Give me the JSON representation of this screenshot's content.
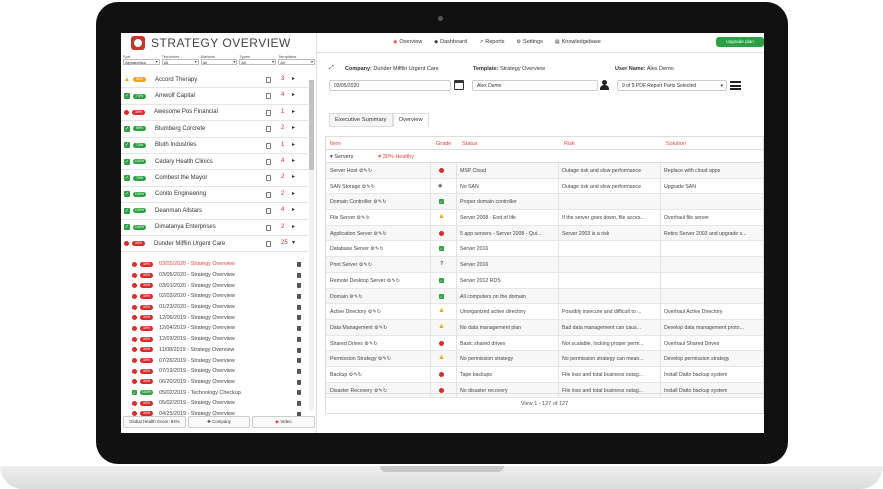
{
  "app": {
    "title": "STRATEGY OVERVIEW"
  },
  "filters": [
    {
      "label": "Sort",
      "value": "Alphabetica"
    },
    {
      "label": "Territories",
      "value": "All"
    },
    {
      "label": "Markets",
      "value": "All"
    },
    {
      "label": "Types",
      "value": "All"
    },
    {
      "label": "Templates",
      "value": "All"
    }
  ],
  "clients": [
    {
      "status": "warning",
      "score": "52%",
      "name": "Accord Therapy",
      "count": "3"
    },
    {
      "status": "ok",
      "score": "70%",
      "name": "Amwolf Capital",
      "count": "4"
    },
    {
      "status": "critical",
      "score": "35%",
      "name": "Awesome Pos Financial",
      "count": "1"
    },
    {
      "status": "ok",
      "score": "59%",
      "name": "Blumberg Corcrete",
      "count": "2"
    },
    {
      "status": "ok",
      "score": "73%",
      "name": "Bluth Industries",
      "count": "1"
    },
    {
      "status": "ok",
      "score": "100%",
      "name": "Cedary Health Clinics",
      "count": "4"
    },
    {
      "status": "ok",
      "score": "75%",
      "name": "Combest the Mayor",
      "count": "2"
    },
    {
      "status": "ok",
      "score": "100%",
      "name": "Conito Engineering",
      "count": "2"
    },
    {
      "status": "ok",
      "score": "100%",
      "name": "Deanman Allstars",
      "count": "4"
    },
    {
      "status": "ok",
      "score": "100%",
      "name": "Dimatanya Enterprises",
      "count": "2"
    },
    {
      "status": "critical",
      "score": "30%",
      "name": "Dunder Mifflin Urgent Care",
      "count": "25"
    }
  ],
  "reports": [
    {
      "status": "critical",
      "score": "30%",
      "label": "03/05/2020 - Strategy Overview",
      "active": true
    },
    {
      "status": "critical",
      "score": "30%",
      "label": "03/05/2020 - Strategy Overview",
      "active": false
    },
    {
      "status": "critical",
      "score": "30%",
      "label": "03/01/2020 - Strategy Overview",
      "active": false
    },
    {
      "status": "critical",
      "score": "30%",
      "label": "02/03/2020 - Strategy Overview",
      "active": false
    },
    {
      "status": "critical",
      "score": "30%",
      "label": "01/23/2020 - Strategy Overview",
      "active": false
    },
    {
      "status": "critical",
      "score": "30%",
      "label": "12/06/2019 - Strategy Overview",
      "active": false
    },
    {
      "status": "critical",
      "score": "30%",
      "label": "12/04/2019 - Strategy Overview",
      "active": false
    },
    {
      "status": "critical",
      "score": "30%",
      "label": "12/03/2019 - Strategy Overview",
      "active": false
    },
    {
      "status": "critical",
      "score": "30%",
      "label": "11/08/2019 - Strategy Overview",
      "active": false
    },
    {
      "status": "critical",
      "score": "30%",
      "label": "07/26/2019 - Strategy Overview",
      "active": false
    },
    {
      "status": "critical",
      "score": "30%",
      "label": "07/19/2019 - Strategy Overview",
      "active": false
    },
    {
      "status": "critical",
      "score": "30%",
      "label": "06/20/2019 - Strategy Overview",
      "active": false
    },
    {
      "status": "ok",
      "score": "100%",
      "label": "05/02/2019 - Technology Checkup",
      "active": false
    },
    {
      "status": "critical",
      "score": "30%",
      "label": "05/02/2019 - Strategy Overview",
      "active": false
    },
    {
      "status": "critical",
      "score": "30%",
      "label": "04/25/2019 - Strategy Overview",
      "active": false
    }
  ],
  "sidebar_footer": {
    "health": "Global Health Score: 84%",
    "company": "Company",
    "video": "Video"
  },
  "nav": [
    {
      "icon": "◉",
      "label": "Overview"
    },
    {
      "icon": "◆",
      "label": "Dashboard"
    },
    {
      "icon": "↗",
      "label": "Reports"
    },
    {
      "icon": "⚙",
      "label": "Settings"
    },
    {
      "icon": "▤",
      "label": "Knowledgebase"
    }
  ],
  "upgrade": "Upgrade plan",
  "info": {
    "company_label": "Company:",
    "company": "Dunder Mifflin Urgent Care",
    "template_label": "Template:",
    "template": "Strategy Overview",
    "user_label": "User Name:",
    "user": "Alex Demo"
  },
  "inputs": {
    "date": "03/05/2020",
    "user": "Alex Demo",
    "parts": "9 of 9 PDF Report Parts Selected"
  },
  "tabs": [
    "Executive Summary",
    "Overview"
  ],
  "table": {
    "headers": [
      "Item",
      "Grade",
      "Status",
      "Risk",
      "Solution"
    ],
    "group": {
      "name": "Servers",
      "score": "30% Healthy"
    },
    "rows": [
      {
        "item": "Server Host",
        "grade": "critical",
        "status": "MSP Cloud",
        "risk": "Outage risk and slow performance",
        "solution": "Replace with cloud apps"
      },
      {
        "item": "SAN Storage",
        "grade": "info",
        "status": "No SAN",
        "risk": "Outage risk and slow performance",
        "solution": "Upgrade SAN"
      },
      {
        "item": "Domain Controller",
        "grade": "ok",
        "status": "Proper domain controller",
        "risk": "",
        "solution": ""
      },
      {
        "item": "File Server",
        "grade": "warning",
        "status": "Server 2008 - End of life",
        "risk": "If the server goes down, file acces...",
        "solution": "Overhaul file server"
      },
      {
        "item": "Application Server",
        "grade": "critical",
        "status": "5 app servers - Server 2008 - Qui...",
        "risk": "Server 2003 is a risk",
        "solution": "Retire Server 2003 and upgrade s..."
      },
      {
        "item": "Database Server",
        "grade": "ok",
        "status": "Server 2016",
        "risk": "",
        "solution": ""
      },
      {
        "item": "Print Server",
        "grade": "unknown",
        "status": "Server 2016",
        "risk": "",
        "solution": ""
      },
      {
        "item": "Remote Desktop Server",
        "grade": "ok",
        "status": "Server 2012 RDS",
        "risk": "",
        "solution": ""
      },
      {
        "item": "Domain",
        "grade": "ok",
        "status": "All computers on the domain",
        "risk": "",
        "solution": ""
      },
      {
        "item": "Active Directory",
        "grade": "warning",
        "status": "Unorganized active directory",
        "risk": "Possibly insecure and difficult to ...",
        "solution": "Overhaul Active Directory"
      },
      {
        "item": "Data Management",
        "grade": "warning",
        "status": "No data management plan",
        "risk": "Bad data management can caus...",
        "solution": "Develop data management proto..."
      },
      {
        "item": "Shared Drives",
        "grade": "critical",
        "status": "Basic shared drives",
        "risk": "Not scalable, locking proper perm...",
        "solution": "Overhaul Shared Drives"
      },
      {
        "item": "Permission Strategy",
        "grade": "warning",
        "status": "No permission strategy",
        "risk": "No permission strategy can mean...",
        "solution": "Develop permission strategy"
      },
      {
        "item": "Backup",
        "grade": "critical",
        "status": "Tape backups",
        "risk": "File loss and total business outag...",
        "solution": "Install Datto backup system"
      },
      {
        "item": "Disaster Recovery",
        "grade": "critical",
        "status": "No disaster recovery",
        "risk": "File loss and total business outag...",
        "solution": "Install Datto backup system"
      }
    ],
    "pager": "View 1 - 127 of 127"
  },
  "colors": {
    "accent": "#e04a3a",
    "ok": "#2ea043",
    "warning": "#f0a500",
    "critical": "#d62c2c",
    "info": "#2a64c5"
  }
}
